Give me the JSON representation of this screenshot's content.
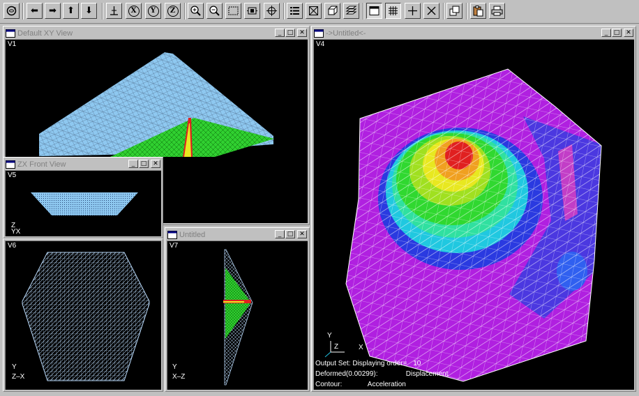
{
  "toolbar": {
    "tools": [
      "rotate-icon",
      "arrow-left-icon",
      "arrow-right-icon",
      "arrow-up-icon",
      "arrow-down-icon",
      "normal-icon",
      "x-axis-icon",
      "y-axis-icon",
      "z-axis-icon",
      "zoom-in-icon",
      "zoom-out-icon",
      "zoom-box-icon",
      "fit-icon",
      "center-icon",
      "list-icon",
      "box-icon",
      "cube-icon",
      "layers-icon",
      "window-icon",
      "grid-icon",
      "plus-icon",
      "cross-icon",
      "copy-icon",
      "paste-icon",
      "print-icon"
    ],
    "axis_x": "X",
    "axis_y": "Y",
    "axis_z": "Z"
  },
  "windows": {
    "v1": {
      "title": "Default XY View",
      "label": "V1"
    },
    "v5": {
      "title": "ZX Front View",
      "label": "V5",
      "axis_top": "Z",
      "axis_bottom": "YX"
    },
    "v6": {
      "label": "V6",
      "axis_top": "Y",
      "axis_bottom": "Z–X"
    },
    "v7": {
      "title": "Untitled",
      "label": "V7",
      "axis_top": "Y",
      "axis_bottom": "X–Z"
    },
    "v4": {
      "title": "->Untitled<-",
      "label": "V4",
      "axis_y": "Y",
      "axis_z": "Z",
      "axis_x": "X",
      "output_set_label": "Output Set: Displaying order=",
      "output_set_value": "10",
      "deformed_label": "Deformed(0.00299):",
      "deformed_value": "Displacement",
      "contour_label": "Contour:",
      "contour_value": "Acceleration"
    }
  },
  "colors": {
    "viewport_bg": "#000000",
    "mesh_light": "#8ec8f0",
    "contour_magenta": "#c020e0",
    "contour_blue": "#2040e0",
    "contour_cyan": "#20c8e0",
    "contour_green": "#30e030",
    "contour_yellow": "#e8e820",
    "contour_red": "#e02020"
  }
}
